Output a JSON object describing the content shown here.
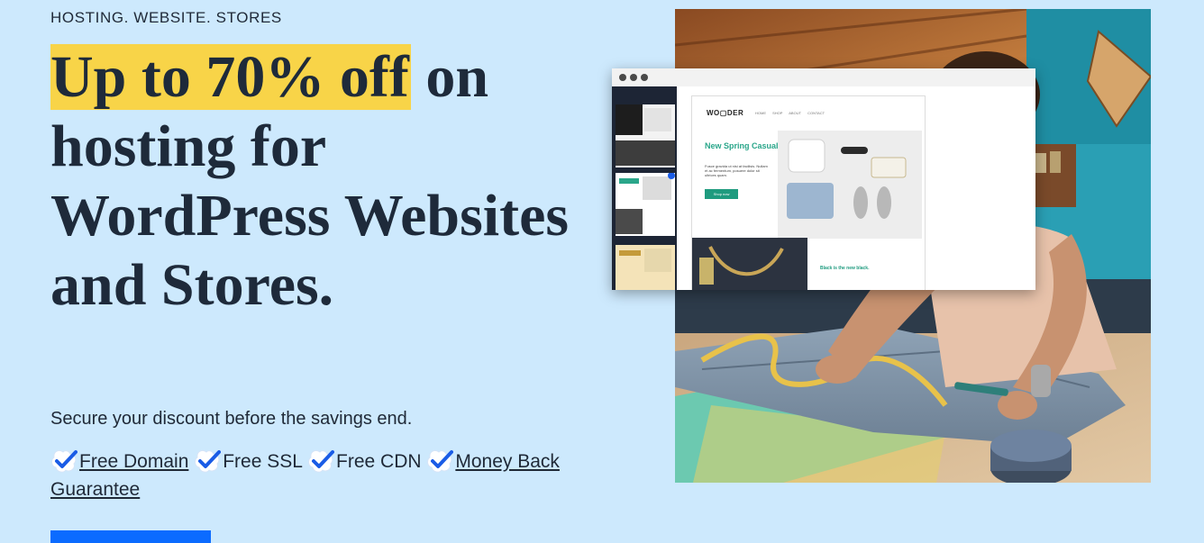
{
  "eyebrow": "HOSTING. WEBSITE. STORES",
  "headline": {
    "highlight": "Up to 70% off",
    "rest": " on hosting for WordPress Websites and Stores."
  },
  "subtext": "Secure your discount before the savings end.",
  "features": [
    {
      "label": "Free Domain",
      "link": true
    },
    {
      "label": "Free SSL",
      "link": false
    },
    {
      "label": "Free CDN",
      "link": false
    },
    {
      "label": "Money Back Guarantee",
      "link": true
    }
  ],
  "mockup": {
    "logo": "WO▢DER",
    "nav": "HOME SHOP ABOUT CONTACT",
    "hero_title": "New Spring Casuals",
    "hero_body": "Fusce gravida ut nisi at facilisis. Nullam et ac fermentum, posuere dolor sit ultrices quam.",
    "hero_button": "Shop now",
    "article_title": "Black is the new black."
  },
  "colors": {
    "background": "#cde9fd",
    "highlight": "#f8d448",
    "cta": "#0b6bff",
    "check": "#1a5ce6",
    "heading": "#1e2a3a"
  },
  "icons": {
    "check": "check-badge-icon"
  }
}
